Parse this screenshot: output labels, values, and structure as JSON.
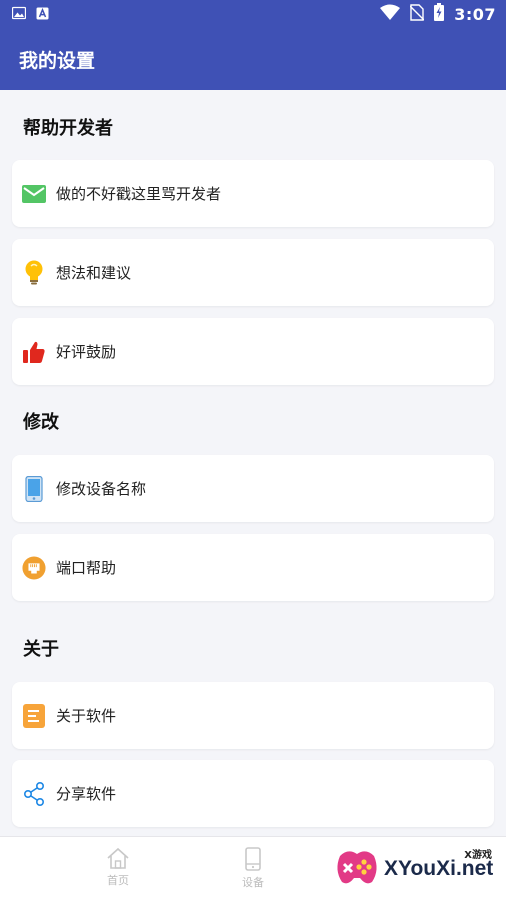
{
  "status": {
    "time": "3:07"
  },
  "app_bar": {
    "title": "我的设置"
  },
  "sections": [
    {
      "title": "帮助开发者",
      "items": [
        {
          "label": "做的不好戳这里骂开发者",
          "icon": "mail-icon"
        },
        {
          "label": "想法和建议",
          "icon": "lightbulb-icon"
        },
        {
          "label": "好评鼓励",
          "icon": "thumbs-up-icon"
        }
      ]
    },
    {
      "title": "修改",
      "items": [
        {
          "label": "修改设备名称",
          "icon": "phone-icon"
        },
        {
          "label": "端口帮助",
          "icon": "ethernet-port-icon"
        }
      ]
    },
    {
      "title": "关于",
      "items": [
        {
          "label": "关于软件",
          "icon": "document-icon"
        },
        {
          "label": "分享软件",
          "icon": "share-icon"
        }
      ]
    }
  ],
  "bottom_nav": {
    "items": [
      {
        "label": "首页"
      },
      {
        "label": "设备"
      }
    ]
  },
  "watermark": {
    "brand": "XYouXi.net",
    "tag": "X游戏"
  },
  "colors": {
    "primary": "#3f51b5",
    "background": "#f4f5f9"
  }
}
